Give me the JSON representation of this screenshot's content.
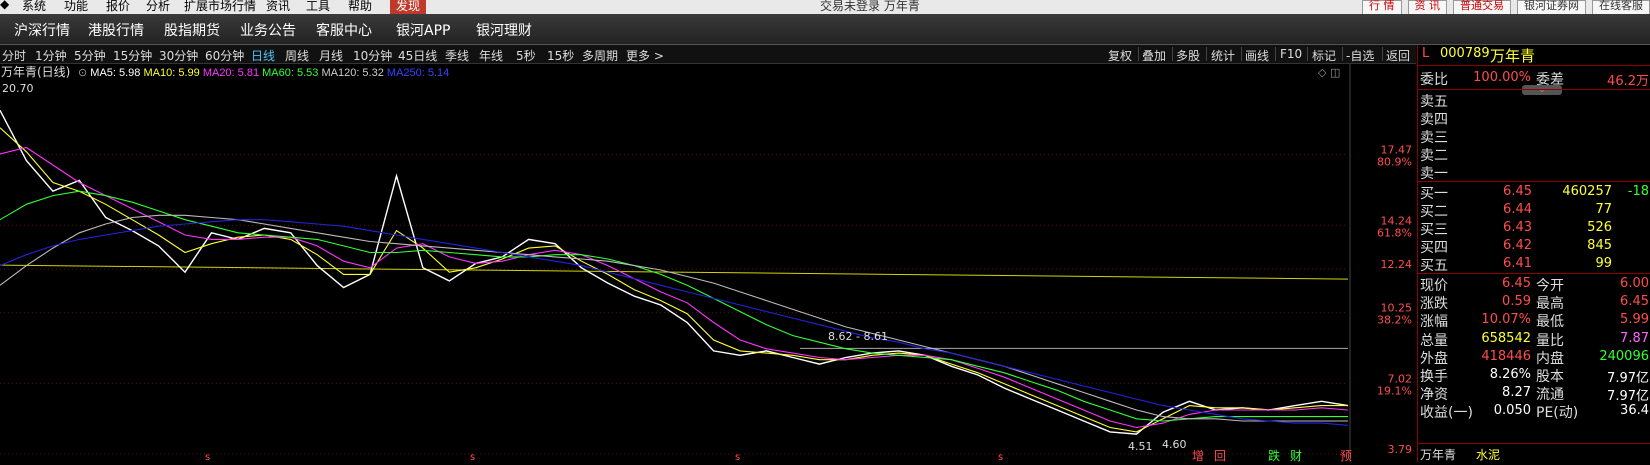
{
  "menubar": {
    "items": [
      "系统",
      "功能",
      "报价",
      "分析",
      "扩展市场行情",
      "资讯",
      "工具",
      "帮助",
      "发现"
    ],
    "window_title": "交易未登录  万年青",
    "right_buttons": [
      "行 情",
      "资 讯",
      "普通交易",
      "银河证券网",
      "在线客服"
    ]
  },
  "nav": {
    "items": [
      "沪深行情",
      "港股行情",
      "股指期货",
      "业务公告",
      "客服中心",
      "银河APP",
      "银河理财"
    ]
  },
  "periods": {
    "items": [
      "分时",
      "1分钟",
      "5分钟",
      "15分钟",
      "30分钟",
      "60分钟",
      "日线",
      "周线",
      "月线",
      "10分钟",
      "45日线",
      "季线",
      "年线",
      "5秒",
      "15秒",
      "多周期",
      "更多 >"
    ],
    "selected": "日线",
    "tools": [
      "复权",
      "叠加",
      "多股",
      "统计",
      "画线",
      "F10",
      "标记",
      "-自选",
      "返回"
    ]
  },
  "chart_header": {
    "title": "万年青(日线)",
    "ma5": "MA5: 5.98",
    "ma10": "MA10: 5.99",
    "ma20": "MA20: 5.81",
    "ma60": "MA60: 5.53",
    "ma120": "MA120: 5.32",
    "ma250": "MA250: 5.14",
    "high_label": "20.70",
    "range_label": "8.62 - 8.61",
    "low_label": "4.51",
    "low_label2": "4.60"
  },
  "chart_data": {
    "type": "line",
    "y_axis_ticks": [
      {
        "value": 17.47,
        "pct": "80.9%"
      },
      {
        "value": 14.24,
        "pct": "61.8%"
      },
      {
        "value": 12.24,
        "pct": ""
      },
      {
        "value": 10.25,
        "pct": "38.2%"
      },
      {
        "value": 7.02,
        "pct": "19.1%"
      },
      {
        "value": 3.79,
        "pct": ""
      }
    ],
    "ylim": [
      3.79,
      20.7
    ],
    "hlines": [
      {
        "value": 12.24,
        "color": "#d4d400"
      },
      {
        "value": 8.62,
        "color": "#aaaaaa"
      }
    ],
    "series": [
      {
        "name": "MA5",
        "color": "#ffffff",
        "values": [
          19.5,
          17.2,
          15.8,
          16.3,
          14.6,
          14.0,
          13.3,
          12.1,
          13.9,
          13.6,
          14.1,
          13.9,
          12.4,
          11.4,
          12.0,
          16.5,
          12.3,
          11.7,
          12.5,
          12.8,
          13.6,
          13.4,
          12.3,
          11.6,
          11.0,
          10.6,
          9.8,
          8.5,
          8.3,
          8.5,
          8.2,
          7.9,
          8.2,
          8.4,
          8.5,
          8.3,
          7.8,
          7.4,
          6.8,
          6.3,
          5.8,
          5.3,
          4.8,
          4.7,
          5.7,
          6.2,
          5.8,
          5.9,
          5.8,
          6.0,
          6.2,
          6.0
        ]
      },
      {
        "name": "MA10",
        "color": "#ffff33",
        "values": [
          18.7,
          17.6,
          16.2,
          15.8,
          15.2,
          14.5,
          13.8,
          13.0,
          13.4,
          13.7,
          13.8,
          13.6,
          12.9,
          12.0,
          12.0,
          14.0,
          13.2,
          12.1,
          12.3,
          12.7,
          13.2,
          13.3,
          12.6,
          12.0,
          11.3,
          10.8,
          10.2,
          9.0,
          8.5,
          8.4,
          8.3,
          8.1,
          8.1,
          8.3,
          8.4,
          8.3,
          7.9,
          7.5,
          7.0,
          6.5,
          6.0,
          5.5,
          5.0,
          4.8,
          5.4,
          6.0,
          5.9,
          5.9,
          5.8,
          5.9,
          6.0,
          6.0
        ]
      },
      {
        "name": "MA20",
        "color": "#ff33ff",
        "values": [
          17.5,
          17.8,
          17.0,
          16.2,
          15.6,
          15.0,
          14.4,
          13.8,
          13.6,
          13.6,
          13.7,
          13.7,
          13.3,
          12.6,
          12.3,
          13.2,
          13.4,
          12.8,
          12.5,
          12.6,
          12.9,
          13.1,
          12.9,
          12.4,
          11.8,
          11.2,
          10.7,
          9.8,
          9.0,
          8.6,
          8.4,
          8.2,
          8.1,
          8.2,
          8.3,
          8.3,
          8.1,
          7.7,
          7.3,
          6.8,
          6.3,
          5.8,
          5.3,
          5.0,
          5.2,
          5.6,
          5.8,
          5.8,
          5.8,
          5.8,
          5.9,
          5.8
        ]
      },
      {
        "name": "MA60",
        "color": "#33ff33",
        "values": [
          14.5,
          15.2,
          15.6,
          15.8,
          15.6,
          15.3,
          14.9,
          14.5,
          14.2,
          13.9,
          13.8,
          13.7,
          13.6,
          13.3,
          13.0,
          13.0,
          13.1,
          13.0,
          12.9,
          12.8,
          12.8,
          12.9,
          12.9,
          12.7,
          12.4,
          12.0,
          11.5,
          10.9,
          10.3,
          9.7,
          9.2,
          8.9,
          8.6,
          8.4,
          8.3,
          8.2,
          8.1,
          7.8,
          7.5,
          7.1,
          6.7,
          6.2,
          5.8,
          5.4,
          5.3,
          5.4,
          5.5,
          5.5,
          5.5,
          5.5,
          5.5,
          5.5
        ]
      },
      {
        "name": "MA120",
        "color": "#bbbbbb",
        "values": [
          11.5,
          12.4,
          13.2,
          13.9,
          14.3,
          14.6,
          14.7,
          14.7,
          14.6,
          14.5,
          14.3,
          14.1,
          13.9,
          13.7,
          13.5,
          13.4,
          13.3,
          13.2,
          13.1,
          13.0,
          12.9,
          12.8,
          12.7,
          12.6,
          12.4,
          12.2,
          11.9,
          11.6,
          11.2,
          10.8,
          10.4,
          10.0,
          9.6,
          9.3,
          9.0,
          8.7,
          8.4,
          8.1,
          7.8,
          7.4,
          7.0,
          6.6,
          6.2,
          5.8,
          5.5,
          5.4,
          5.4,
          5.3,
          5.3,
          5.3,
          5.3,
          5.3
        ]
      },
      {
        "name": "MA250",
        "color": "#2222dd",
        "values": [
          12.4,
          12.9,
          13.3,
          13.6,
          13.8,
          14.0,
          14.2,
          14.3,
          14.4,
          14.5,
          14.5,
          14.4,
          14.3,
          14.2,
          14.0,
          13.8,
          13.6,
          13.4,
          13.2,
          13.0,
          12.8,
          12.6,
          12.4,
          12.1,
          11.8,
          11.5,
          11.2,
          10.9,
          10.6,
          10.3,
          10.0,
          9.7,
          9.4,
          9.1,
          8.9,
          8.6,
          8.4,
          8.1,
          7.8,
          7.5,
          7.2,
          6.9,
          6.6,
          6.3,
          6.0,
          5.8,
          5.6,
          5.4,
          5.3,
          5.2,
          5.2,
          5.1
        ]
      }
    ],
    "bottom_markers": [
      "增",
      "回",
      "跌",
      "财",
      "预"
    ],
    "title": "",
    "xlabel": "",
    "ylabel": ""
  },
  "quote": {
    "code": "000789",
    "name": "万年青",
    "prefix": "L",
    "weibi_label": "委比",
    "weibi_value": "100.00%",
    "weicha_label": "委差",
    "weicha_value": "46.2万",
    "sell": [
      {
        "label": "卖五"
      },
      {
        "label": "卖四"
      },
      {
        "label": "卖三"
      },
      {
        "label": "卖二"
      },
      {
        "label": "卖一"
      }
    ],
    "buy": [
      {
        "label": "买一",
        "price": "6.45",
        "vol": "460257",
        "extra": "-18"
      },
      {
        "label": "买二",
        "price": "6.44",
        "vol": "77"
      },
      {
        "label": "买三",
        "price": "6.43",
        "vol": "526"
      },
      {
        "label": "买四",
        "price": "6.42",
        "vol": "845"
      },
      {
        "label": "买五",
        "price": "6.41",
        "vol": "99"
      }
    ],
    "stats": [
      {
        "l1": "现价",
        "v1": "6.45",
        "c1": "red",
        "l2": "今开",
        "v2": "6.00",
        "c2": "red"
      },
      {
        "l1": "涨跌",
        "v1": "0.59",
        "c1": "red",
        "l2": "最高",
        "v2": "6.45",
        "c2": "red"
      },
      {
        "l1": "涨幅",
        "v1": "10.07%",
        "c1": "red",
        "l2": "最低",
        "v2": "5.99",
        "c2": "red"
      },
      {
        "l1": "总量",
        "v1": "658542",
        "c1": "yel",
        "l2": "量比",
        "v2": "7.87",
        "c2": "pur"
      },
      {
        "l1": "外盘",
        "v1": "418446",
        "c1": "red",
        "l2": "内盘",
        "v2": "240096",
        "c2": "grn"
      },
      {
        "l1": "换手",
        "v1": "8.26%",
        "c1": "wht",
        "l2": "股本",
        "v2": "7.97亿",
        "c2": "wht"
      },
      {
        "l1": "净资",
        "v1": "8.27",
        "c1": "wht",
        "l2": "流通",
        "v2": "7.97亿",
        "c2": "wht"
      },
      {
        "l1": "收益(一)",
        "v1": "0.050",
        "c1": "wht",
        "l2": "PE(动)",
        "v2": "36.4",
        "c2": "wht"
      }
    ],
    "footer_name": "万年青",
    "footer_tag": "水泥"
  }
}
